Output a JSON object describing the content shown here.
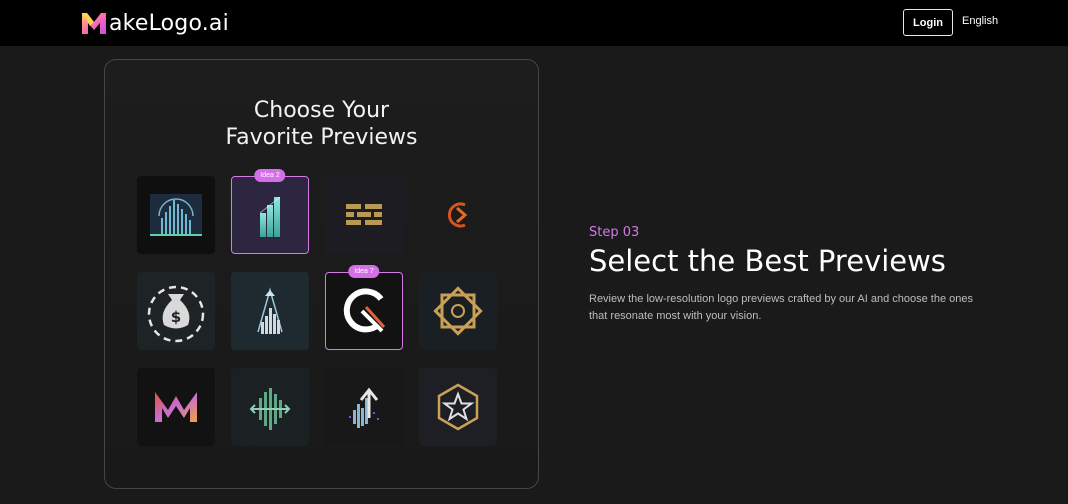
{
  "header": {
    "brand_name": "akeLogo.ai",
    "logo_icon": "m-letter-logo-icon",
    "login_label": "Login",
    "language_label": "English"
  },
  "card": {
    "title_line1": "Choose Your",
    "title_line2": "Favorite Previews",
    "accent_color": "#d77ae8",
    "tiles": [
      {
        "name": "skyline-chart-logo",
        "icon": "dome-bar-chart-icon",
        "selected": false,
        "badge": ""
      },
      {
        "name": "teal-bars-logo",
        "icon": "teal-bar-chart-icon",
        "selected": true,
        "badge": "Idea 2"
      },
      {
        "name": "gold-bricks-logo",
        "icon": "gold-brick-pattern-icon",
        "selected": false,
        "badge": ""
      },
      {
        "name": "orange-arrow-logo",
        "icon": "circular-arrow-icon",
        "selected": false,
        "badge": ""
      },
      {
        "name": "money-bag-logo",
        "icon": "dollar-bag-icon",
        "selected": false,
        "badge": ""
      },
      {
        "name": "arrow-bars-logo",
        "icon": "upward-arrow-bars-icon",
        "selected": false,
        "badge": ""
      },
      {
        "name": "speed-gauge-logo",
        "icon": "gauge-icon",
        "selected": true,
        "badge": "Idea 7"
      },
      {
        "name": "gold-star-emblem-logo",
        "icon": "eight-point-star-icon",
        "selected": false,
        "badge": ""
      },
      {
        "name": "colorful-m-logo",
        "icon": "m-zigzag-icon",
        "selected": false,
        "badge": ""
      },
      {
        "name": "green-arrow-bars-logo",
        "icon": "horizontal-arrow-bars-icon",
        "selected": false,
        "badge": ""
      },
      {
        "name": "pixel-arrow-logo",
        "icon": "pixel-up-arrow-icon",
        "selected": false,
        "badge": ""
      },
      {
        "name": "star-badge-logo",
        "icon": "hexagon-star-icon",
        "selected": false,
        "badge": ""
      }
    ]
  },
  "feature": {
    "step_label": "Step 03",
    "headline": "Select the Best Previews",
    "description": "Review the low-resolution logo previews crafted by our AI and choose the ones that resonate most with your vision."
  }
}
